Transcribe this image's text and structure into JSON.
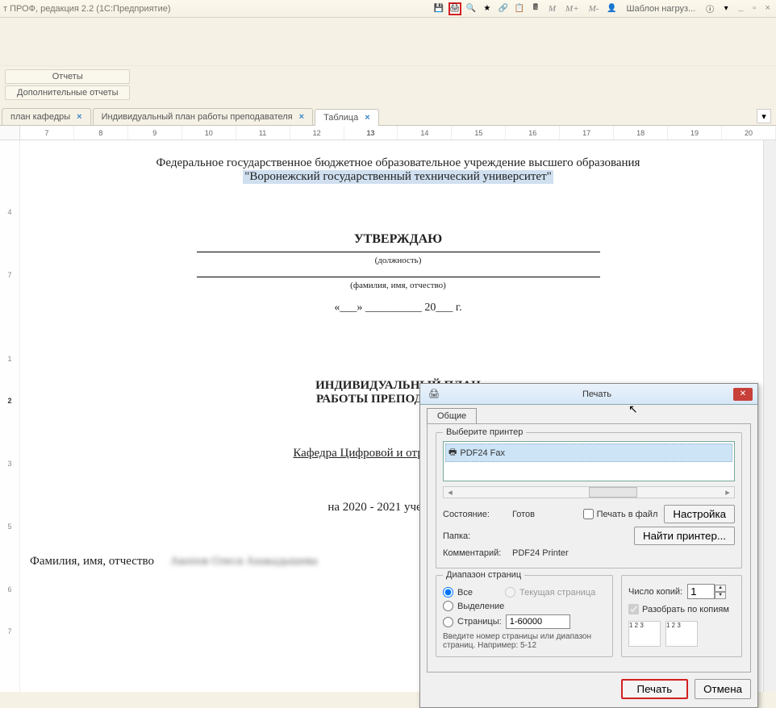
{
  "titlebar": {
    "text": "т ПРОФ, редакция 2.2  (1С:Предприятие)",
    "memo": [
      "M",
      "M+",
      "M-"
    ],
    "user": "Шаблон нагруз...",
    "win": [
      "_",
      "▫",
      "×"
    ]
  },
  "toolbar": {
    "b1": "Отчеты",
    "b2": "Дополнительные отчеты"
  },
  "tabs": [
    {
      "label": "план кафедры",
      "active": false
    },
    {
      "label": "Индивидуальный план работы преподавателя",
      "active": false
    },
    {
      "label": "Таблица",
      "active": true
    }
  ],
  "ruler": [
    "7",
    "8",
    "9",
    "10",
    "11",
    "12",
    "13",
    "14",
    "15",
    "16",
    "17",
    "18",
    "19",
    "20"
  ],
  "ruler_current": "13",
  "rows": [
    "",
    "",
    "",
    "",
    "",
    "4",
    "",
    "",
    "7",
    "",
    "",
    "",
    "1",
    "",
    "2",
    "",
    "",
    "3",
    "",
    "",
    "5",
    "",
    "",
    "6",
    "",
    "",
    "7"
  ],
  "row_current": "2",
  "document": {
    "header1": "Федеральное государственное бюджетное образовательное учреждение высшего образования",
    "header2": "\"Воронежский государственный технический университет\"",
    "approve": "УТВЕРЖДАЮ",
    "position": "(должность)",
    "fio": "(фамилия, имя, отчество)",
    "date": "«___» __________ 20___  г.",
    "title1": "ИНДИВИДУАЛЬНЫЙ ПЛАН",
    "title2": "РАБОТЫ ПРЕПОДАВАТЕЛЯ",
    "dept": "Кафедра Цифровой и отраслевой эконом",
    "year": "на 2020 - 2021 учебный год",
    "fio_label": "Фамилия, имя, отчество",
    "fio_value": "Акопов Олеся Анакадышева"
  },
  "print": {
    "title": "Печать",
    "tab": "Общие",
    "select_printer": "Выберите принтер",
    "printer": "PDF24 Fax",
    "state_label": "Состояние:",
    "state_value": "Готов",
    "folder_label": "Папка:",
    "comment_label": "Комментарий:",
    "comment_value": "PDF24 Printer",
    "print_to_file": "Печать в файл",
    "settings": "Настройка",
    "find_printer": "Найти принтер...",
    "range_label": "Диапазон страниц",
    "all": "Все",
    "current_page": "Текущая страница",
    "selection": "Выделение",
    "pages": "Страницы:",
    "pages_value": "1-60000",
    "note": "Введите номер страницы или диапазон страниц. Например: 5-12",
    "copies_label": "Число копий:",
    "copies_value": "1",
    "collate": "Разобрать по копиям",
    "print_btn": "Печать",
    "cancel_btn": "Отмена"
  }
}
